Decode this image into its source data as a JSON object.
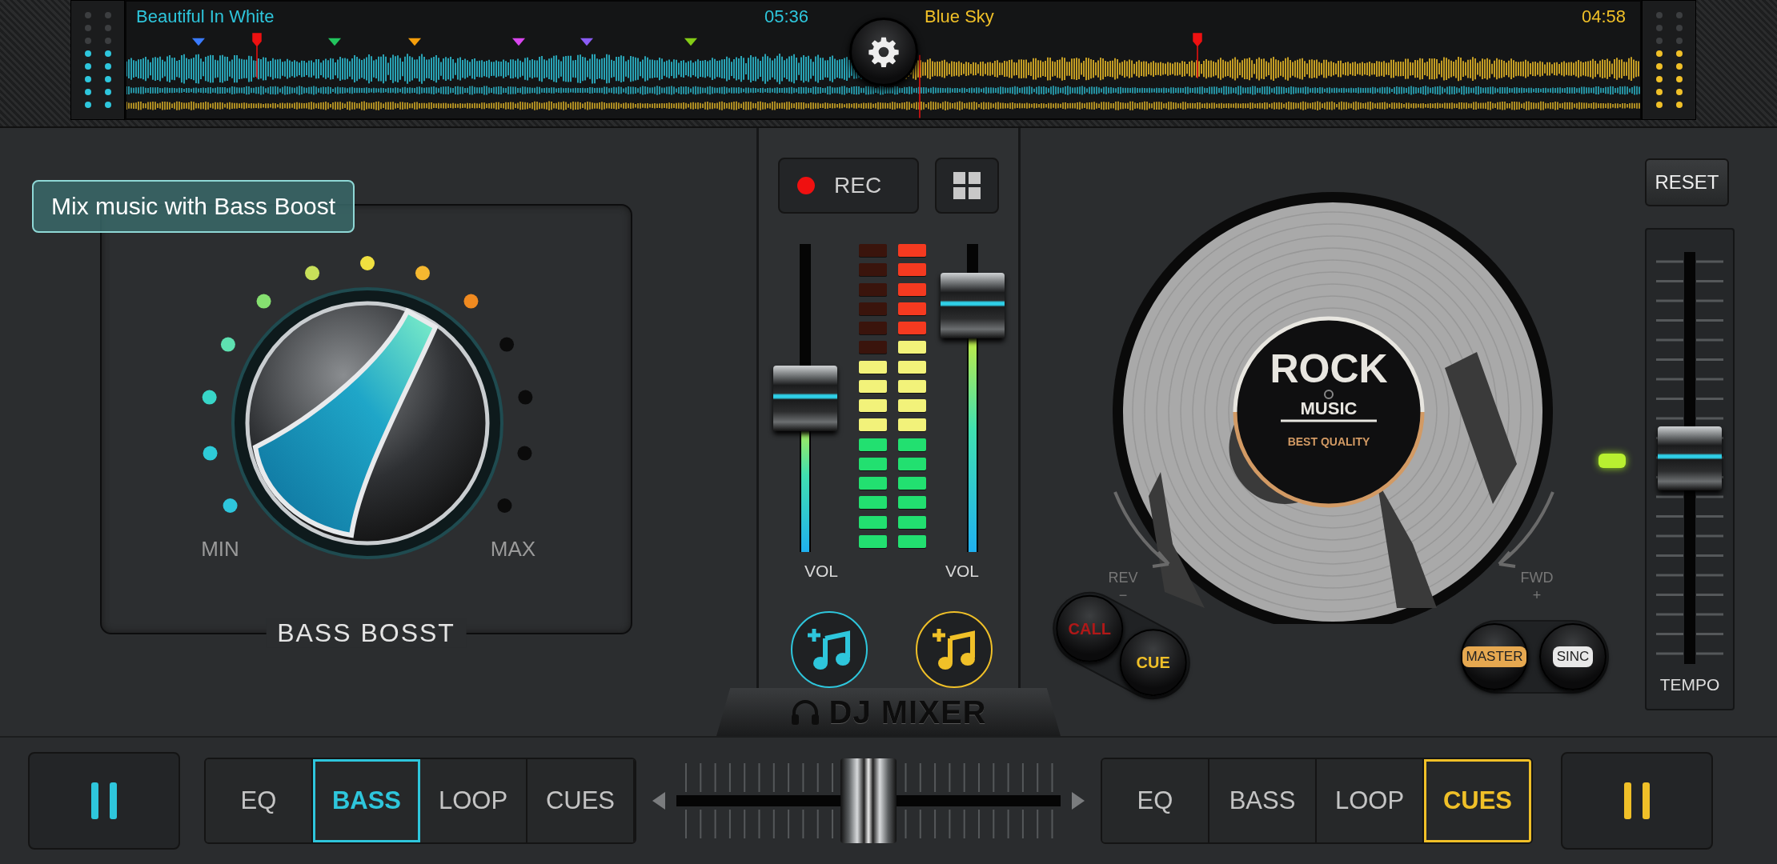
{
  "waveform": {
    "decks": [
      {
        "title": "Beautiful In White",
        "time": "05:36",
        "color": "#2ec6dc"
      },
      {
        "title": "Blue Sky",
        "time": "04:58",
        "color": "#f0c028"
      }
    ]
  },
  "tooltip": "Mix music with Bass Boost",
  "bass_boost": {
    "title": "BASS BOSST",
    "min_label": "MIN",
    "max_label": "MAX",
    "dots": [
      {
        "lit": true
      },
      {
        "lit": true
      },
      {
        "lit": true
      },
      {
        "lit": true
      },
      {
        "lit": true
      },
      {
        "lit": true
      },
      {
        "lit": true
      },
      {
        "lit": true
      },
      {
        "lit": true
      },
      {
        "lit": false
      },
      {
        "lit": false
      },
      {
        "lit": false
      },
      {
        "lit": false
      }
    ]
  },
  "mixer": {
    "rec": "REC",
    "channels": [
      {
        "level": 0.5,
        "meter": [
          {
            "lit": false
          },
          {
            "lit": false
          },
          {
            "lit": false
          },
          {
            "lit": false
          },
          {
            "lit": false
          },
          {
            "lit": false
          },
          {
            "lit": true
          },
          {
            "lit": true
          },
          {
            "lit": true
          },
          {
            "lit": true
          },
          {
            "lit": true
          },
          {
            "lit": true
          },
          {
            "lit": true
          },
          {
            "lit": true
          },
          {
            "lit": true
          },
          {
            "lit": true
          }
        ],
        "label": "VOL",
        "color": "#2ec6dc"
      },
      {
        "level": 0.8,
        "meter": [
          {
            "lit": true
          },
          {
            "lit": true
          },
          {
            "lit": true
          },
          {
            "lit": true
          },
          {
            "lit": true
          },
          {
            "lit": true
          },
          {
            "lit": true
          },
          {
            "lit": true
          },
          {
            "lit": true
          },
          {
            "lit": true
          },
          {
            "lit": true
          },
          {
            "lit": true
          },
          {
            "lit": true
          },
          {
            "lit": true
          },
          {
            "lit": true
          },
          {
            "lit": true
          }
        ],
        "label": "VOL",
        "color": "#f0c028"
      }
    ],
    "logo": "DJ MIXER"
  },
  "deck": {
    "reset": "RESET",
    "record_label": {
      "title": "ROCK",
      "subtitle": "MUSIC",
      "tagline": "BEST QUALITY"
    },
    "rev": "REV",
    "rev_sign": "−",
    "fwd": "FWD",
    "fwd_sign": "+",
    "call": "CALL",
    "cue": "CUE",
    "master": "MASTER",
    "sync": "SINC",
    "tempo": {
      "label": "TEMPO",
      "level": 0.5
    }
  },
  "bottom": {
    "decks": [
      {
        "color": "#2ec6dc",
        "tabs": [
          {
            "label": "EQ",
            "selected": false
          },
          {
            "label": "BASS",
            "selected": true
          },
          {
            "label": "LOOP",
            "selected": false
          },
          {
            "label": "CUES",
            "selected": false
          }
        ]
      },
      {
        "color": "#f0c028",
        "tabs": [
          {
            "label": "EQ",
            "selected": false
          },
          {
            "label": "BASS",
            "selected": false
          },
          {
            "label": "LOOP",
            "selected": false
          },
          {
            "label": "CUES",
            "selected": true
          }
        ]
      }
    ],
    "crossfader": {
      "level": 0.5
    }
  }
}
